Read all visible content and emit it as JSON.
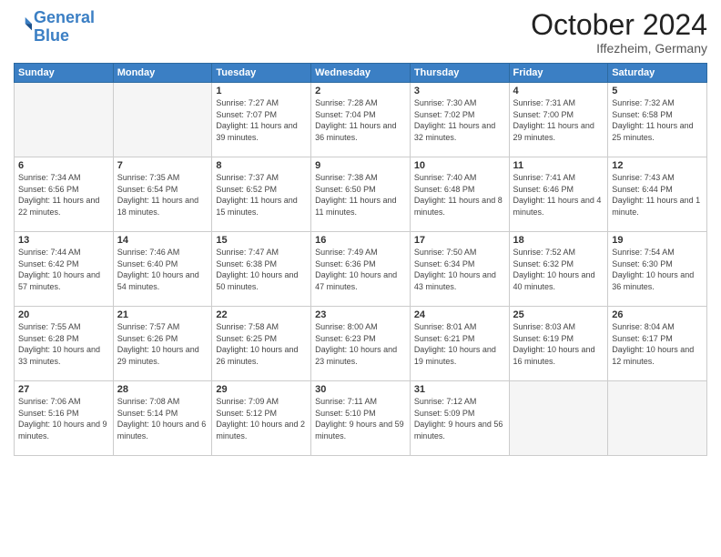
{
  "header": {
    "logo_line1": "General",
    "logo_line2": "Blue",
    "month": "October 2024",
    "location": "Iffezheim, Germany"
  },
  "weekdays": [
    "Sunday",
    "Monday",
    "Tuesday",
    "Wednesday",
    "Thursday",
    "Friday",
    "Saturday"
  ],
  "weeks": [
    [
      {
        "day": "",
        "info": ""
      },
      {
        "day": "",
        "info": ""
      },
      {
        "day": "1",
        "info": "Sunrise: 7:27 AM\nSunset: 7:07 PM\nDaylight: 11 hours\nand 39 minutes."
      },
      {
        "day": "2",
        "info": "Sunrise: 7:28 AM\nSunset: 7:04 PM\nDaylight: 11 hours\nand 36 minutes."
      },
      {
        "day": "3",
        "info": "Sunrise: 7:30 AM\nSunset: 7:02 PM\nDaylight: 11 hours\nand 32 minutes."
      },
      {
        "day": "4",
        "info": "Sunrise: 7:31 AM\nSunset: 7:00 PM\nDaylight: 11 hours\nand 29 minutes."
      },
      {
        "day": "5",
        "info": "Sunrise: 7:32 AM\nSunset: 6:58 PM\nDaylight: 11 hours\nand 25 minutes."
      }
    ],
    [
      {
        "day": "6",
        "info": "Sunrise: 7:34 AM\nSunset: 6:56 PM\nDaylight: 11 hours\nand 22 minutes."
      },
      {
        "day": "7",
        "info": "Sunrise: 7:35 AM\nSunset: 6:54 PM\nDaylight: 11 hours\nand 18 minutes."
      },
      {
        "day": "8",
        "info": "Sunrise: 7:37 AM\nSunset: 6:52 PM\nDaylight: 11 hours\nand 15 minutes."
      },
      {
        "day": "9",
        "info": "Sunrise: 7:38 AM\nSunset: 6:50 PM\nDaylight: 11 hours\nand 11 minutes."
      },
      {
        "day": "10",
        "info": "Sunrise: 7:40 AM\nSunset: 6:48 PM\nDaylight: 11 hours\nand 8 minutes."
      },
      {
        "day": "11",
        "info": "Sunrise: 7:41 AM\nSunset: 6:46 PM\nDaylight: 11 hours\nand 4 minutes."
      },
      {
        "day": "12",
        "info": "Sunrise: 7:43 AM\nSunset: 6:44 PM\nDaylight: 11 hours\nand 1 minute."
      }
    ],
    [
      {
        "day": "13",
        "info": "Sunrise: 7:44 AM\nSunset: 6:42 PM\nDaylight: 10 hours\nand 57 minutes."
      },
      {
        "day": "14",
        "info": "Sunrise: 7:46 AM\nSunset: 6:40 PM\nDaylight: 10 hours\nand 54 minutes."
      },
      {
        "day": "15",
        "info": "Sunrise: 7:47 AM\nSunset: 6:38 PM\nDaylight: 10 hours\nand 50 minutes."
      },
      {
        "day": "16",
        "info": "Sunrise: 7:49 AM\nSunset: 6:36 PM\nDaylight: 10 hours\nand 47 minutes."
      },
      {
        "day": "17",
        "info": "Sunrise: 7:50 AM\nSunset: 6:34 PM\nDaylight: 10 hours\nand 43 minutes."
      },
      {
        "day": "18",
        "info": "Sunrise: 7:52 AM\nSunset: 6:32 PM\nDaylight: 10 hours\nand 40 minutes."
      },
      {
        "day": "19",
        "info": "Sunrise: 7:54 AM\nSunset: 6:30 PM\nDaylight: 10 hours\nand 36 minutes."
      }
    ],
    [
      {
        "day": "20",
        "info": "Sunrise: 7:55 AM\nSunset: 6:28 PM\nDaylight: 10 hours\nand 33 minutes."
      },
      {
        "day": "21",
        "info": "Sunrise: 7:57 AM\nSunset: 6:26 PM\nDaylight: 10 hours\nand 29 minutes."
      },
      {
        "day": "22",
        "info": "Sunrise: 7:58 AM\nSunset: 6:25 PM\nDaylight: 10 hours\nand 26 minutes."
      },
      {
        "day": "23",
        "info": "Sunrise: 8:00 AM\nSunset: 6:23 PM\nDaylight: 10 hours\nand 23 minutes."
      },
      {
        "day": "24",
        "info": "Sunrise: 8:01 AM\nSunset: 6:21 PM\nDaylight: 10 hours\nand 19 minutes."
      },
      {
        "day": "25",
        "info": "Sunrise: 8:03 AM\nSunset: 6:19 PM\nDaylight: 10 hours\nand 16 minutes."
      },
      {
        "day": "26",
        "info": "Sunrise: 8:04 AM\nSunset: 6:17 PM\nDaylight: 10 hours\nand 12 minutes."
      }
    ],
    [
      {
        "day": "27",
        "info": "Sunrise: 7:06 AM\nSunset: 5:16 PM\nDaylight: 10 hours\nand 9 minutes."
      },
      {
        "day": "28",
        "info": "Sunrise: 7:08 AM\nSunset: 5:14 PM\nDaylight: 10 hours\nand 6 minutes."
      },
      {
        "day": "29",
        "info": "Sunrise: 7:09 AM\nSunset: 5:12 PM\nDaylight: 10 hours\nand 2 minutes."
      },
      {
        "day": "30",
        "info": "Sunrise: 7:11 AM\nSunset: 5:10 PM\nDaylight: 9 hours\nand 59 minutes."
      },
      {
        "day": "31",
        "info": "Sunrise: 7:12 AM\nSunset: 5:09 PM\nDaylight: 9 hours\nand 56 minutes."
      },
      {
        "day": "",
        "info": ""
      },
      {
        "day": "",
        "info": ""
      }
    ]
  ]
}
